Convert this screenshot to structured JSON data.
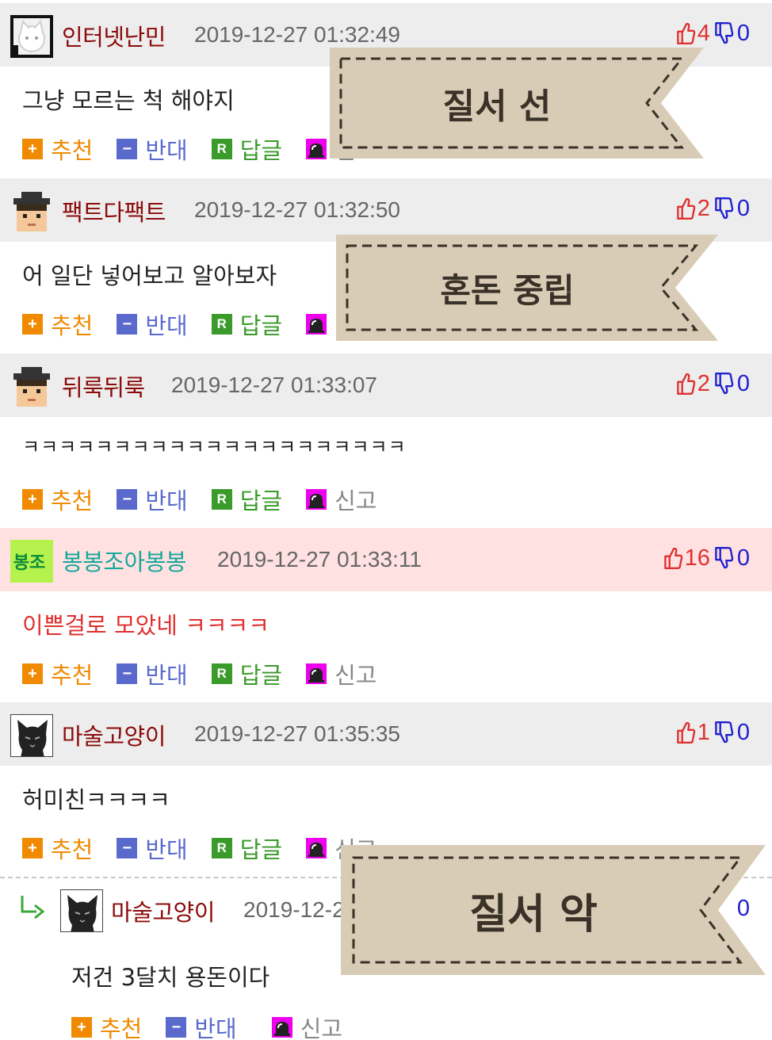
{
  "comments": [
    {
      "nickname": "인터넷난민",
      "date": "2019-12-27 01:32:49",
      "up": "4",
      "down": "0",
      "text": "그냥 모르는 척 해야지",
      "actions": {
        "recommend": "추천",
        "oppose": "반대",
        "reply": "답글",
        "report": "신고"
      }
    },
    {
      "nickname": "팩트다팩트",
      "date": "2019-12-27 01:32:50",
      "up": "2",
      "down": "0",
      "text": "어 일단 넣어보고 알아보자",
      "actions": {
        "recommend": "추천",
        "oppose": "반대",
        "reply": "답글",
        "report": "신고"
      }
    },
    {
      "nickname": "뒤룩뒤룩",
      "date": "2019-12-27 01:33:07",
      "up": "2",
      "down": "0",
      "text": "ㅋㅋㅋㅋㅋㅋㅋㅋㅋㅋㅋㅋㅋㅋㅋㅋㅋㅋㅋㅋㅋ",
      "actions": {
        "recommend": "추천",
        "oppose": "반대",
        "reply": "답글",
        "report": "신고"
      }
    },
    {
      "nickname": "봉봉조아봉봉",
      "avatar_text": "봉조",
      "date": "2019-12-27 01:33:11",
      "up": "16",
      "down": "0",
      "text": "이쁜걸로 모았네 ㅋㅋㅋㅋ",
      "actions": {
        "recommend": "추천",
        "oppose": "반대",
        "reply": "답글",
        "report": "신고"
      }
    },
    {
      "nickname": "마술고양이",
      "date": "2019-12-27 01:35:35",
      "up": "1",
      "down": "0",
      "text": "허미친ㅋㅋㅋㅋ",
      "actions": {
        "recommend": "추천",
        "oppose": "반대",
        "reply": "답글",
        "report": "신고"
      }
    }
  ],
  "reply": {
    "nickname": "마술고양이",
    "date": "2019-12-2",
    "down": "0",
    "text": "저건 3달치 용돈이다",
    "actions": {
      "recommend": "추천",
      "oppose": "반대",
      "report": "신고"
    }
  },
  "banners": [
    "질서 선",
    "혼돈 중립",
    "질서 악"
  ],
  "colors": {
    "header_bg": "#ededed",
    "best_header_bg": "#ffe1e1",
    "nickname": "#8b0a0a",
    "best_nickname": "#14a89a",
    "recommend": "#f08a00",
    "oppose": "#5a6acc",
    "reply": "#3a9a2a",
    "report_icon": "#ee00ee",
    "banner_fill": "#d9ccb6"
  },
  "icons": {
    "thumbs_up": "thumbs-up-icon",
    "thumbs_down": "thumbs-down-icon",
    "reply_arrow": "reply-arrow-icon",
    "siren": "siren-icon"
  }
}
